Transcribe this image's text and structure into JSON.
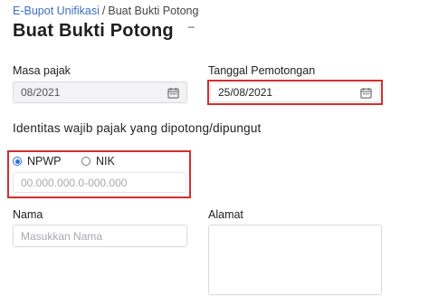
{
  "breadcrumb": {
    "root": "E-Bupot Unifikasi",
    "separator": "/",
    "current": "Buat Bukti Potong"
  },
  "page_title": "Buat Bukti Potong",
  "collapse_icon": "minus-icon",
  "masa_pajak": {
    "label": "Masa pajak",
    "value": "08/2021",
    "icon": "calendar-icon"
  },
  "tanggal_pemotongan": {
    "label": "Tanggal Pemotongan",
    "value": "25/08/2021",
    "icon": "calendar-icon"
  },
  "identitas": {
    "heading": "Identitas wajib pajak yang dipotong/dipungut",
    "options": [
      "NPWP",
      "NIK"
    ],
    "selected": "NPWP",
    "npwp_placeholder": "00.000.000.0-000.000"
  },
  "nama": {
    "label": "Nama",
    "placeholder": "Masukkan Nama"
  },
  "alamat": {
    "label": "Alamat"
  },
  "colors": {
    "link": "#3a6fc4",
    "highlight": "#d32f2f",
    "radio_selected": "#2f6fd6"
  }
}
